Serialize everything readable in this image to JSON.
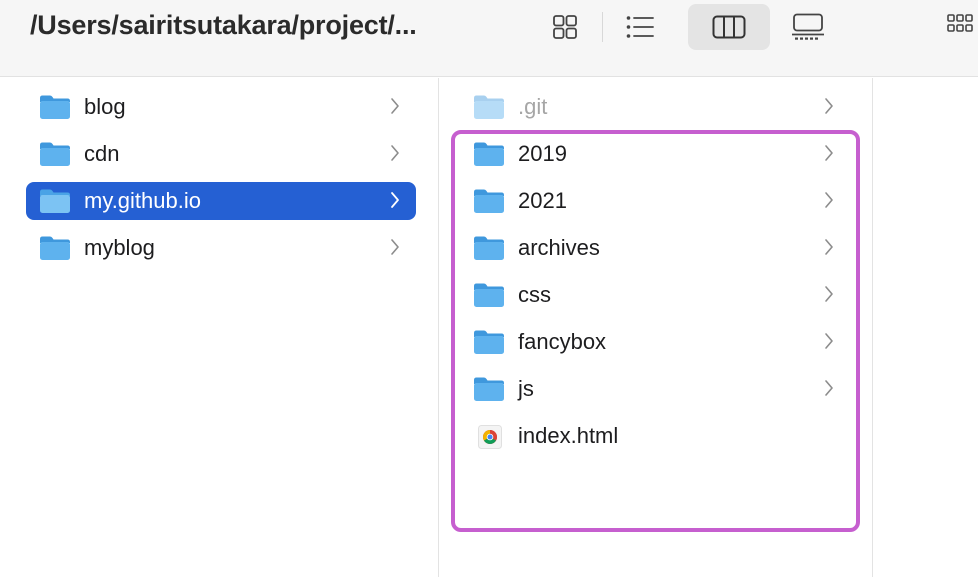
{
  "toolbar": {
    "path_title": "/Users/sairitsutakara/project/...",
    "views": [
      {
        "name": "icon-view",
        "active": false
      },
      {
        "name": "list-view",
        "active": false
      },
      {
        "name": "column-view",
        "active": true
      },
      {
        "name": "gallery-view",
        "active": false
      },
      {
        "name": "group-view",
        "active": false
      }
    ]
  },
  "columns": [
    {
      "items": [
        {
          "label": "blog",
          "type": "folder",
          "selected": false
        },
        {
          "label": "cdn",
          "type": "folder",
          "selected": false
        },
        {
          "label": "my.github.io",
          "type": "folder",
          "selected": true
        },
        {
          "label": "myblog",
          "type": "folder",
          "selected": false
        }
      ]
    },
    {
      "items": [
        {
          "label": ".git",
          "type": "folder",
          "hidden": true
        },
        {
          "label": "2019",
          "type": "folder"
        },
        {
          "label": "2021",
          "type": "folder"
        },
        {
          "label": "archives",
          "type": "folder"
        },
        {
          "label": "css",
          "type": "folder"
        },
        {
          "label": "fancybox",
          "type": "folder"
        },
        {
          "label": "js",
          "type": "folder"
        },
        {
          "label": "index.html",
          "type": "html-file"
        }
      ]
    }
  ],
  "colors": {
    "selection": "#2560d3",
    "highlight_outline": "#c65fcf",
    "folder_front": "#5eb2ee",
    "folder_back": "#3f98dd"
  }
}
